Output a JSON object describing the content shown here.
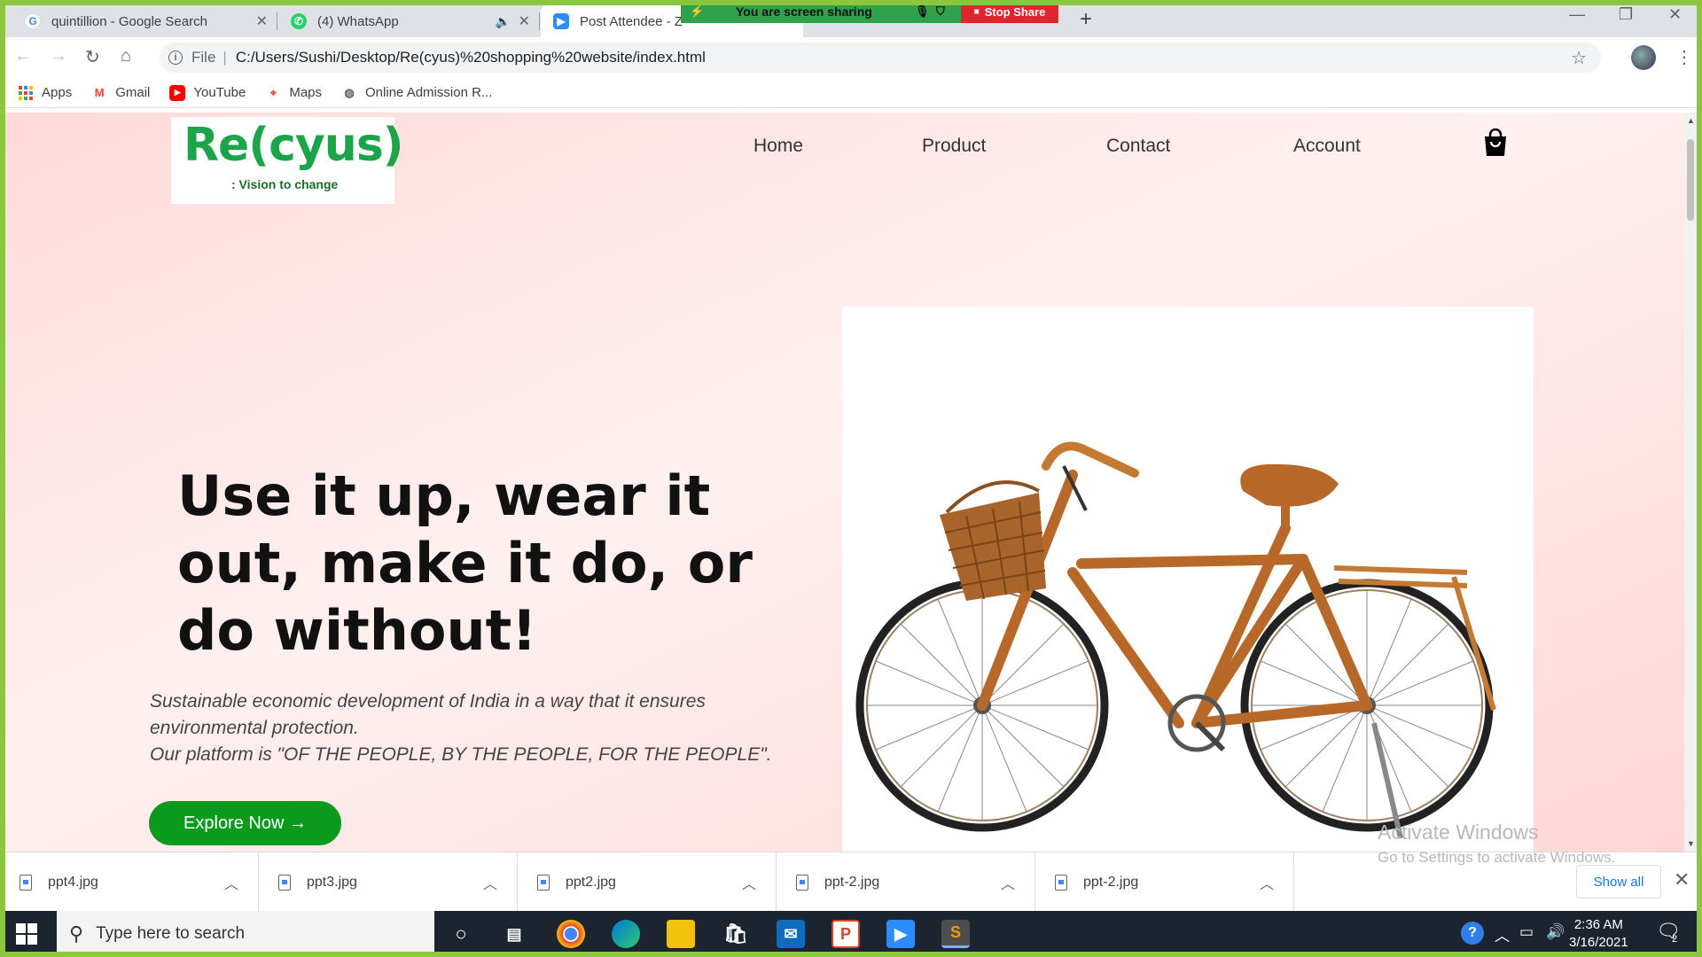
{
  "browser": {
    "tabs": [
      {
        "title": "quintillion - Google Search",
        "favicon": "G"
      },
      {
        "title": "(4) WhatsApp",
        "favicon": "W"
      },
      {
        "title": "Post Attendee - Z",
        "favicon": "Z"
      }
    ],
    "screen_share": {
      "status": "You are screen sharing",
      "stop_label": "Stop Share"
    },
    "address": {
      "scheme_label": "File",
      "url": "C:/Users/Sushi/Desktop/Re(cyus)%20shopping%20website/index.html"
    },
    "bookmarks": [
      {
        "label": "Apps"
      },
      {
        "label": "Gmail"
      },
      {
        "label": "YouTube"
      },
      {
        "label": "Maps"
      },
      {
        "label": "Online Admission R..."
      }
    ]
  },
  "site": {
    "logo": {
      "brand": "Re(cyus)",
      "tagline": ": Vision to change"
    },
    "nav": [
      "Home",
      "Product",
      "Contact",
      "Account"
    ],
    "hero": {
      "title": "Use it up, wear it out, make it do, or do without!",
      "subtitle_line1": "Sustainable economic development of India in a way that it ensures environmental protection.",
      "subtitle_line2": "Our platform is \"OF THE PEOPLE, BY THE PEOPLE, FOR THE PEOPLE\".",
      "cta": "Explore Now →"
    }
  },
  "watermark": {
    "line1": "Activate Windows",
    "line2": "Go to Settings to activate Windows."
  },
  "downloads": {
    "items": [
      "ppt4.jpg",
      "ppt3.jpg",
      "ppt2.jpg",
      "ppt-2.jpg",
      "ppt-2.jpg"
    ],
    "show_all": "Show all"
  },
  "taskbar": {
    "search_placeholder": "Type here to search",
    "time": "2:36 AM",
    "date": "3/16/2021",
    "notification_count": "2"
  },
  "colors": {
    "accent_green": "#0c9a1c",
    "brand_green": "#1ca44a",
    "share_border": "#8cc63e"
  }
}
